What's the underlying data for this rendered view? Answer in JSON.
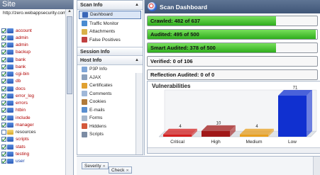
{
  "site": {
    "title": "Site",
    "root": "http://zero.webappsecurity.com/",
    "items": [
      {
        "label": "account",
        "checked": true,
        "folder": "blue",
        "color": "red"
      },
      {
        "label": "admin",
        "checked": true,
        "folder": "blue",
        "color": "red"
      },
      {
        "label": "admin",
        "checked": true,
        "folder": "blue",
        "color": "red"
      },
      {
        "label": "backup",
        "checked": true,
        "folder": "blue",
        "color": "red"
      },
      {
        "label": "bank",
        "checked": true,
        "folder": "blue",
        "color": "red"
      },
      {
        "label": "bank",
        "checked": true,
        "folder": "blue",
        "color": "red"
      },
      {
        "label": "cgi-bin",
        "checked": true,
        "folder": "blue",
        "color": "red"
      },
      {
        "label": "db",
        "checked": true,
        "folder": "blue",
        "color": "red"
      },
      {
        "label": "docs",
        "checked": true,
        "folder": "blue",
        "color": "red"
      },
      {
        "label": "error_log",
        "checked": true,
        "folder": "blue",
        "color": "red"
      },
      {
        "label": "errors",
        "checked": true,
        "folder": "blue",
        "color": "red"
      },
      {
        "label": "htbin",
        "checked": true,
        "folder": "blue",
        "color": "red"
      },
      {
        "label": "include",
        "checked": true,
        "folder": "blue",
        "color": "red"
      },
      {
        "label": "manager",
        "checked": true,
        "folder": "blue",
        "color": "red"
      },
      {
        "label": "resources",
        "checked": false,
        "folder": "yellow",
        "color": "black"
      },
      {
        "label": "scripts",
        "checked": true,
        "folder": "blue",
        "color": "red"
      },
      {
        "label": "stats",
        "checked": true,
        "folder": "blue",
        "color": "red"
      },
      {
        "label": "testing",
        "checked": true,
        "folder": "blue",
        "color": "red"
      },
      {
        "label": "user",
        "checked": true,
        "folder": "blue",
        "color": "blue"
      }
    ]
  },
  "nav": {
    "scan_info": {
      "title": "Scan Info",
      "items": [
        {
          "label": "Dashboard",
          "icon": "dashboard-icon",
          "color": "#3a67b8",
          "selected": true
        },
        {
          "label": "Traffic Monitor",
          "icon": "traffic-monitor-icon",
          "color": "#4a8bd0"
        },
        {
          "label": "Attachments",
          "icon": "attachments-icon",
          "color": "#d9b24a"
        },
        {
          "label": "False Positives",
          "icon": "false-positives-icon",
          "color": "#c04040"
        }
      ]
    },
    "session_info": {
      "title": "Session Info"
    },
    "host_info": {
      "title": "Host Info",
      "items": [
        {
          "label": "P3P Info",
          "icon": "p3p-icon",
          "color": "#7fa6d8"
        },
        {
          "label": "AJAX",
          "icon": "ajax-icon",
          "color": "#8aa0bd"
        },
        {
          "label": "Certificates",
          "icon": "certificates-icon",
          "color": "#e0a030"
        },
        {
          "label": "Comments",
          "icon": "comments-icon",
          "color": "#9fb7d8"
        },
        {
          "label": "Cookies",
          "icon": "cookies-icon",
          "color": "#b07a3a"
        },
        {
          "label": "E-mails",
          "icon": "emails-icon",
          "color": "#5a8fd0"
        },
        {
          "label": "Forms",
          "icon": "forms-icon",
          "color": "#a8b8cc"
        },
        {
          "label": "Hiddens",
          "icon": "hiddens-icon",
          "color": "#d4583a"
        },
        {
          "label": "Scripts",
          "icon": "scripts-icon",
          "color": "#7c8ca4"
        }
      ]
    }
  },
  "dashboard": {
    "title": "Scan Dashboard",
    "stats": [
      {
        "label": "Crawled: 482 of 637",
        "fraction": 0.757
      },
      {
        "label": "Audited: 495 of 500",
        "fraction": 0.99
      },
      {
        "label": "Smart Audited: 378 of 500",
        "fraction": 0.756
      },
      {
        "label": "Verified: 0 of 106",
        "fraction": 0
      },
      {
        "label": "Reflection Audited: 0 of 0",
        "fraction": 0
      }
    ],
    "vulnerabilities_title": "Vulnerabilities"
  },
  "chart_data": {
    "type": "bar",
    "title": "Vulnerabilities",
    "categories": [
      "Critical",
      "High",
      "Medium",
      "Low"
    ],
    "values": [
      4,
      10,
      4,
      71
    ],
    "colors": [
      "#d42020",
      "#a01818",
      "#e8a020",
      "#1030d0"
    ],
    "ylim": [
      0,
      71
    ]
  },
  "groupby": {
    "chips": [
      "Severity",
      "Check"
    ]
  },
  "colors": {
    "header": "#4f6585",
    "progress": "#3cba24"
  }
}
